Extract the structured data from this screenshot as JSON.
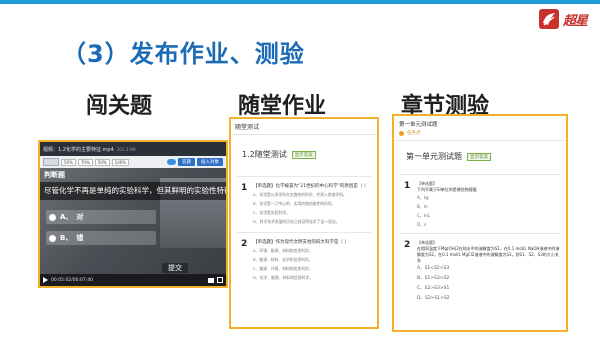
{
  "page": {
    "title": "（3）发布作业、测验",
    "logo_text": "超星",
    "accent_colors": {
      "title": "#1b6bb6",
      "border": "#f3b02a",
      "top_bar": "#1f9bd6",
      "logo": "#c8322e"
    }
  },
  "sections": [
    {
      "heading": "闯关题"
    },
    {
      "heading": "随堂作业"
    },
    {
      "heading": "章节测验"
    }
  ],
  "video_quiz": {
    "window_title": "视频：1.2化学的主要特征.mp4",
    "file_size": "303.3 MB",
    "speed_chips": [
      "50%",
      "70%",
      "50%",
      "100%"
    ],
    "primary_button": "答题",
    "secondary_button": "插入对象",
    "question_type": "判断题",
    "question": "尽管化学不再是单纯的实验科学，但其鲜明的实验性特征",
    "options": [
      {
        "letter": "A、",
        "text": "对"
      },
      {
        "letter": "B、",
        "text": "错"
      }
    ],
    "submit_label": "提交",
    "time": "00:05:02/00:07:40"
  },
  "class_homework": {
    "header": "随堂测试",
    "title": "1.2随堂测试",
    "tag": "显示答案",
    "questions": [
      {
        "number": "1",
        "stem": "【单选题】化学被誉为“21世纪的中心科学”的原因是（  ）",
        "options": [
          "A、化学是以多学科交叉融合的科学，并渗入其他学科。",
          "B、化学是一门中心的、实用的和创造性的科学。",
          "C、化学是实验科学。",
          "D、科学技术发展的历史已经证明化学了这一说法。"
        ]
      },
      {
        "number": "2",
        "stem": "【单选题】作为现代文明支柱的四大科学是（  ）",
        "options": [
          "A、环境、能源、材料和信息科学。",
          "B、能源、材料、化学和信息科学。",
          "C、能源、环境、材料和信息科学。",
          "D、化学、能源、材料和信息科学。"
        ]
      }
    ]
  },
  "chapter_test": {
    "header": "第一单元测试题",
    "mini_label": "任务点",
    "title": "第一单元测试题",
    "tag": "显示答案",
    "questions": [
      {
        "number": "1",
        "kind": "【单选题】",
        "stem": "下列不属于SI单位的是哪些物理量",
        "options": [
          "A、kg",
          "B、m",
          "C、mL",
          "D、s"
        ]
      },
      {
        "number": "2",
        "kind": "【单选题】",
        "stem": "在相同温度下Mg(OH)2在纯水中的溶解度为S1，在0.1 mol/L NaOH溶液中的溶解度为S2，在0.1 mol/L MgCl2溶液中的溶解度为S3，则S1、S2、S3的大小关系",
        "options": [
          "A、S1<S2<S3",
          "B、S1>S3>S2",
          "C、S2>S3>S1",
          "D、S3>S1>S2"
        ]
      }
    ]
  }
}
